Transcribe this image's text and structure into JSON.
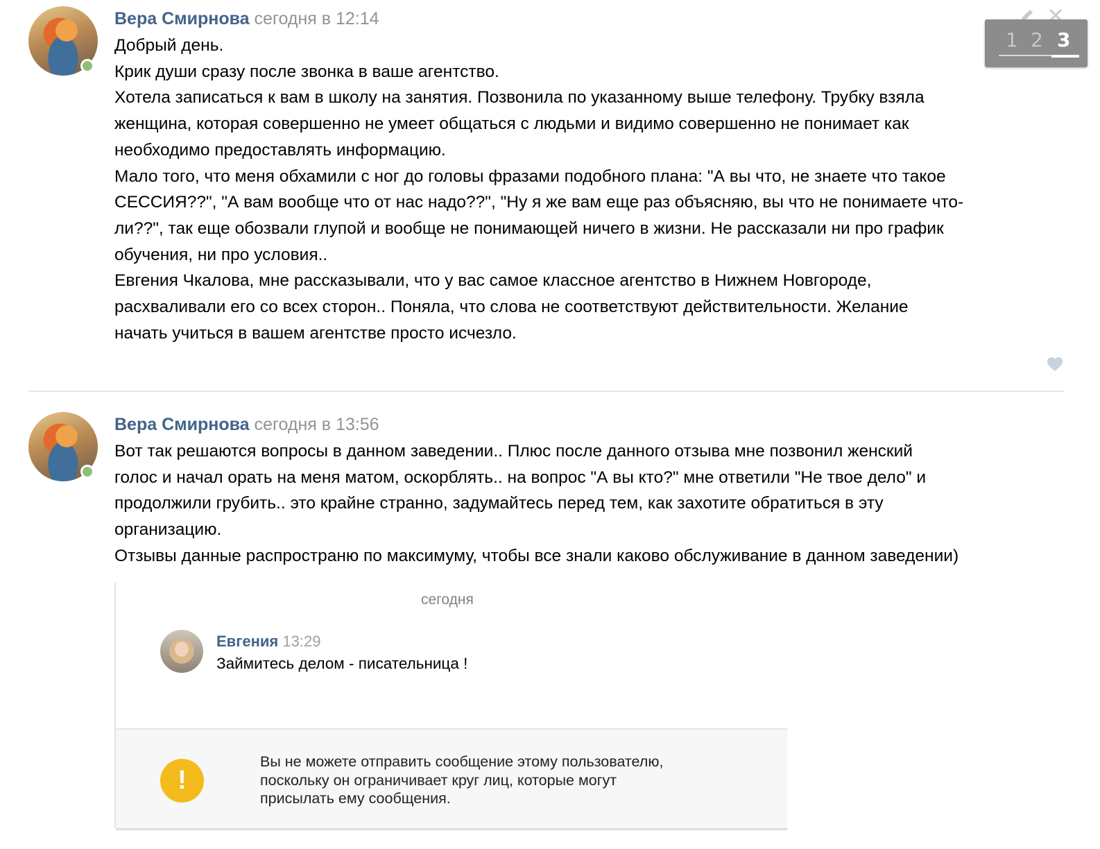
{
  "colors": {
    "author_link": "#42648b",
    "timestamp": "#939393",
    "online_indicator": "#8ac176",
    "warning_icon": "#f4bb1d",
    "pager_background": "#8c8c8c"
  },
  "pager": {
    "pages": [
      "1",
      "2",
      "3"
    ],
    "active_page": "3"
  },
  "toolbar_icons": [
    "edit-pencil-icon",
    "close-icon"
  ],
  "posts": [
    {
      "author": "Вера Смирнова",
      "time": "сегодня в 12:14",
      "online": true,
      "lines": [
        "Добрый день.",
        "Крик души сразу после звонка в ваше агентство.",
        "Хотела записаться к вам в школу на занятия. Позвонила по указанному выше телефону. Трубку взяла",
        "женщина, которая совершенно не умеет общаться с людьми и видимо совершенно не понимает как",
        "необходимо предоставлять информацию.",
        "Мало того, что меня обхамили с ног до головы фразами подобного плана: \"А вы что, не знаете что такое",
        "СЕССИЯ??\", \"А вам вообще что от нас надо??\", \"Ну я же вам еще раз объясняю, вы что не понимаете что-",
        "ли??\", так еще обозвали глупой и вообще не понимающей ничего в жизни. Не рассказали ни про график",
        "обучения, ни про условия..",
        "Евгения Чкалова, мне рассказывали, что у вас самое классное агентство в Нижнем Новгороде,",
        "расхваливали его со всех сторон.. Поняла, что слова не соответствуют действительности. Желание",
        "начать учиться в вашем агентстве просто исчезло."
      ]
    },
    {
      "author": "Вера Смирнова",
      "time": "сегодня в 13:56",
      "online": true,
      "lines": [
        "Вот так решаются вопросы в данном заведении.. Плюс после данного отзыва мне позвонил женский",
        "голос и начал орать на меня матом, оскорблять.. на вопрос \"А вы кто?\" мне ответили \"Не твое дело\" и",
        "продолжили грубить.. это крайне странно, задумайтесь перед тем, как захотите обратиться в эту",
        "организацию.",
        "Отзывы данные распространю по максимуму, чтобы все знали каково обслуживание в данном заведении)"
      ]
    }
  ],
  "attachment": {
    "date_label": "сегодня",
    "message": {
      "author": "Евгения",
      "time": "13:29",
      "text": "Займитесь делом - писательница !"
    },
    "notice": {
      "icon_symbol": "!",
      "lines": [
        "Вы не можете отправить сообщение этому пользователю,",
        "поскольку он ограничивает круг лиц, которые могут",
        "присылать ему сообщения."
      ]
    }
  }
}
